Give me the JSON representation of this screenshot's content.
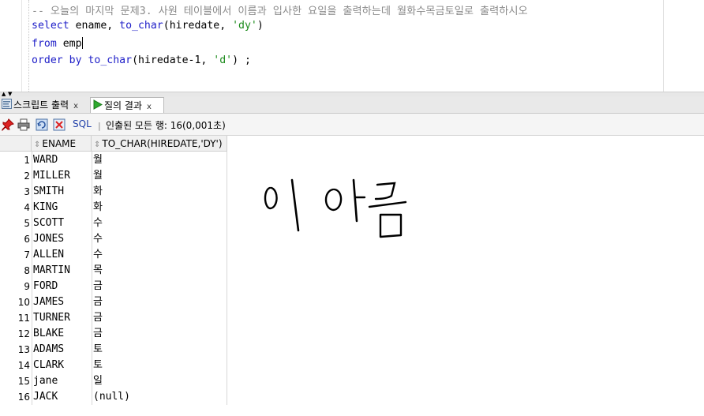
{
  "editor": {
    "comment": "-- 오늘의 마지막 문제3. 사원 테이블에서 이름과 입사한 요일을 출력하는데 월화수목금토일로 출력하시오",
    "line1": {
      "k1": "select",
      "t1": " ename, ",
      "f1": "to_char",
      "t2": "(hiredate, ",
      "s1": "'dy'",
      "t3": ")"
    },
    "line2": {
      "k1": "from",
      "t1": " emp"
    },
    "line3": {
      "k1": "order by",
      "t1": " ",
      "f1": "to_char",
      "t2": "(hiredate-1, ",
      "s1": "'d'",
      "t3": ") ;"
    }
  },
  "tabs": [
    {
      "label": "스크립트 출력",
      "close": "x",
      "icon": "script-output-icon"
    },
    {
      "label": "질의 결과",
      "close": "x",
      "icon": "run-query-icon"
    }
  ],
  "toolbar": {
    "sql_label": "SQL",
    "separator": "|",
    "status": "인출된 모든 행: 16(0,001초)",
    "icons": [
      "pin-icon",
      "print-icon",
      "refresh-icon",
      "export-icon"
    ]
  },
  "columns": [
    "ENAME",
    "TO_CHAR(HIREDATE,'DY')"
  ],
  "rows": [
    {
      "n": "1",
      "ename": "WARD",
      "dy": "월"
    },
    {
      "n": "2",
      "ename": "MILLER",
      "dy": "월"
    },
    {
      "n": "3",
      "ename": "SMITH",
      "dy": "화"
    },
    {
      "n": "4",
      "ename": "KING",
      "dy": "화"
    },
    {
      "n": "5",
      "ename": "SCOTT",
      "dy": "수"
    },
    {
      "n": "6",
      "ename": "JONES",
      "dy": "수"
    },
    {
      "n": "7",
      "ename": "ALLEN",
      "dy": "수"
    },
    {
      "n": "8",
      "ename": "MARTIN",
      "dy": "목"
    },
    {
      "n": "9",
      "ename": "FORD",
      "dy": "금"
    },
    {
      "n": "10",
      "ename": "JAMES",
      "dy": "금"
    },
    {
      "n": "11",
      "ename": "TURNER",
      "dy": "금"
    },
    {
      "n": "12",
      "ename": "BLAKE",
      "dy": "금"
    },
    {
      "n": "13",
      "ename": "ADAMS",
      "dy": "토"
    },
    {
      "n": "14",
      "ename": "CLARK",
      "dy": "토"
    },
    {
      "n": "15",
      "ename": "jane",
      "dy": "일"
    },
    {
      "n": "16",
      "ename": " JACK",
      "dy": "(null)"
    }
  ],
  "handwriting": "이 아름",
  "colors": {
    "keyword": "#1e1ec8",
    "string": "#1a8a1a",
    "comment": "#8a8a8a"
  }
}
